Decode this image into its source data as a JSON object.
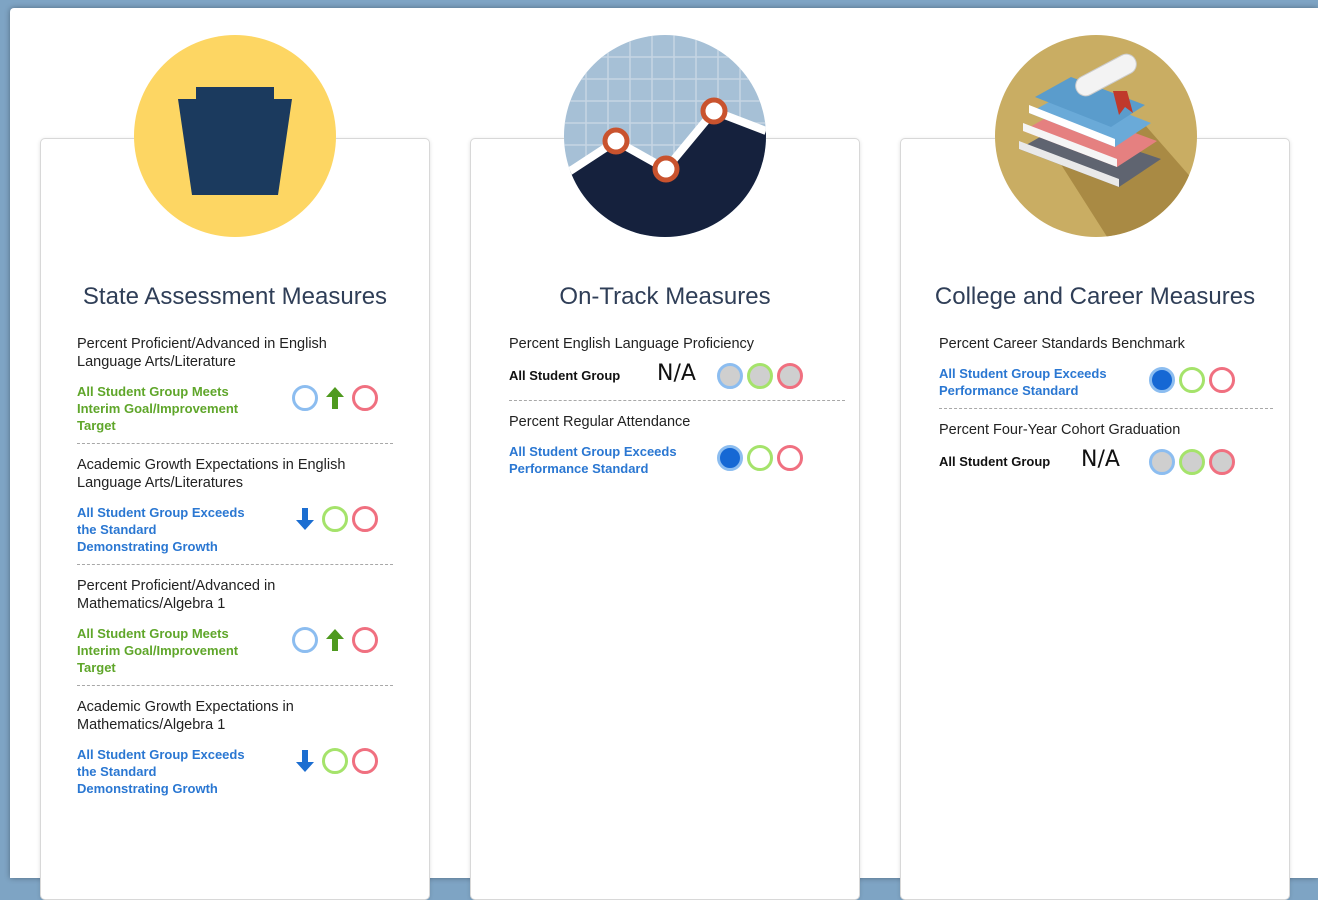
{
  "columns": [
    {
      "title": "State Assessment Measures",
      "badge_icon": "keystone-icon",
      "measures": [
        {
          "name": "Percent Proficient/Advanced in English Language Arts/Literature",
          "group_status": "All Student Group Meets Interim Goal/Improvement Target",
          "status_color": "green",
          "indicator": "up-arrow"
        },
        {
          "name": "Academic Growth Expectations in English Language Arts/Literatures",
          "group_status": "All Student Group Exceeds the Standard Demonstrating Growth",
          "status_color": "blue",
          "indicator": "down-arrow"
        },
        {
          "name": "Percent Proficient/Advanced in Mathematics/Algebra 1",
          "group_status": "All Student Group Meets Interim Goal/Improvement Target",
          "status_color": "green",
          "indicator": "up-arrow"
        },
        {
          "name": "Academic Growth Expectations in Mathematics/Algebra 1",
          "group_status": "All Student Group Exceeds the Standard Demonstrating Growth",
          "status_color": "blue",
          "indicator": "down-arrow"
        }
      ]
    },
    {
      "title": "On-Track Measures",
      "badge_icon": "line-chart-icon",
      "measures": [
        {
          "name": "Percent English Language Proficiency",
          "group_status": "All Student Group",
          "status_color": "black",
          "na_label": "N/A",
          "indicator": "not-available"
        },
        {
          "name": "Percent Regular Attendance",
          "group_status": "All Student Group Exceeds Performance Standard",
          "status_color": "blue",
          "indicator": "exceeds"
        }
      ]
    },
    {
      "title": "College and Career Measures",
      "badge_icon": "books-diploma-icon",
      "measures": [
        {
          "name": "Percent Career Standards Benchmark",
          "group_status": "All Student Group Exceeds Performance Standard",
          "status_color": "blue",
          "indicator": "exceeds"
        },
        {
          "name": "Percent Four-Year Cohort Graduation",
          "group_status": "All Student Group",
          "status_color": "black",
          "na_label": "N/A",
          "indicator": "not-available"
        }
      ]
    }
  ],
  "colors": {
    "green": "#5fa62a",
    "blue": "#2a77d2",
    "badge_yellow": "#fdd663",
    "badge_gold": "#c9ad63"
  }
}
